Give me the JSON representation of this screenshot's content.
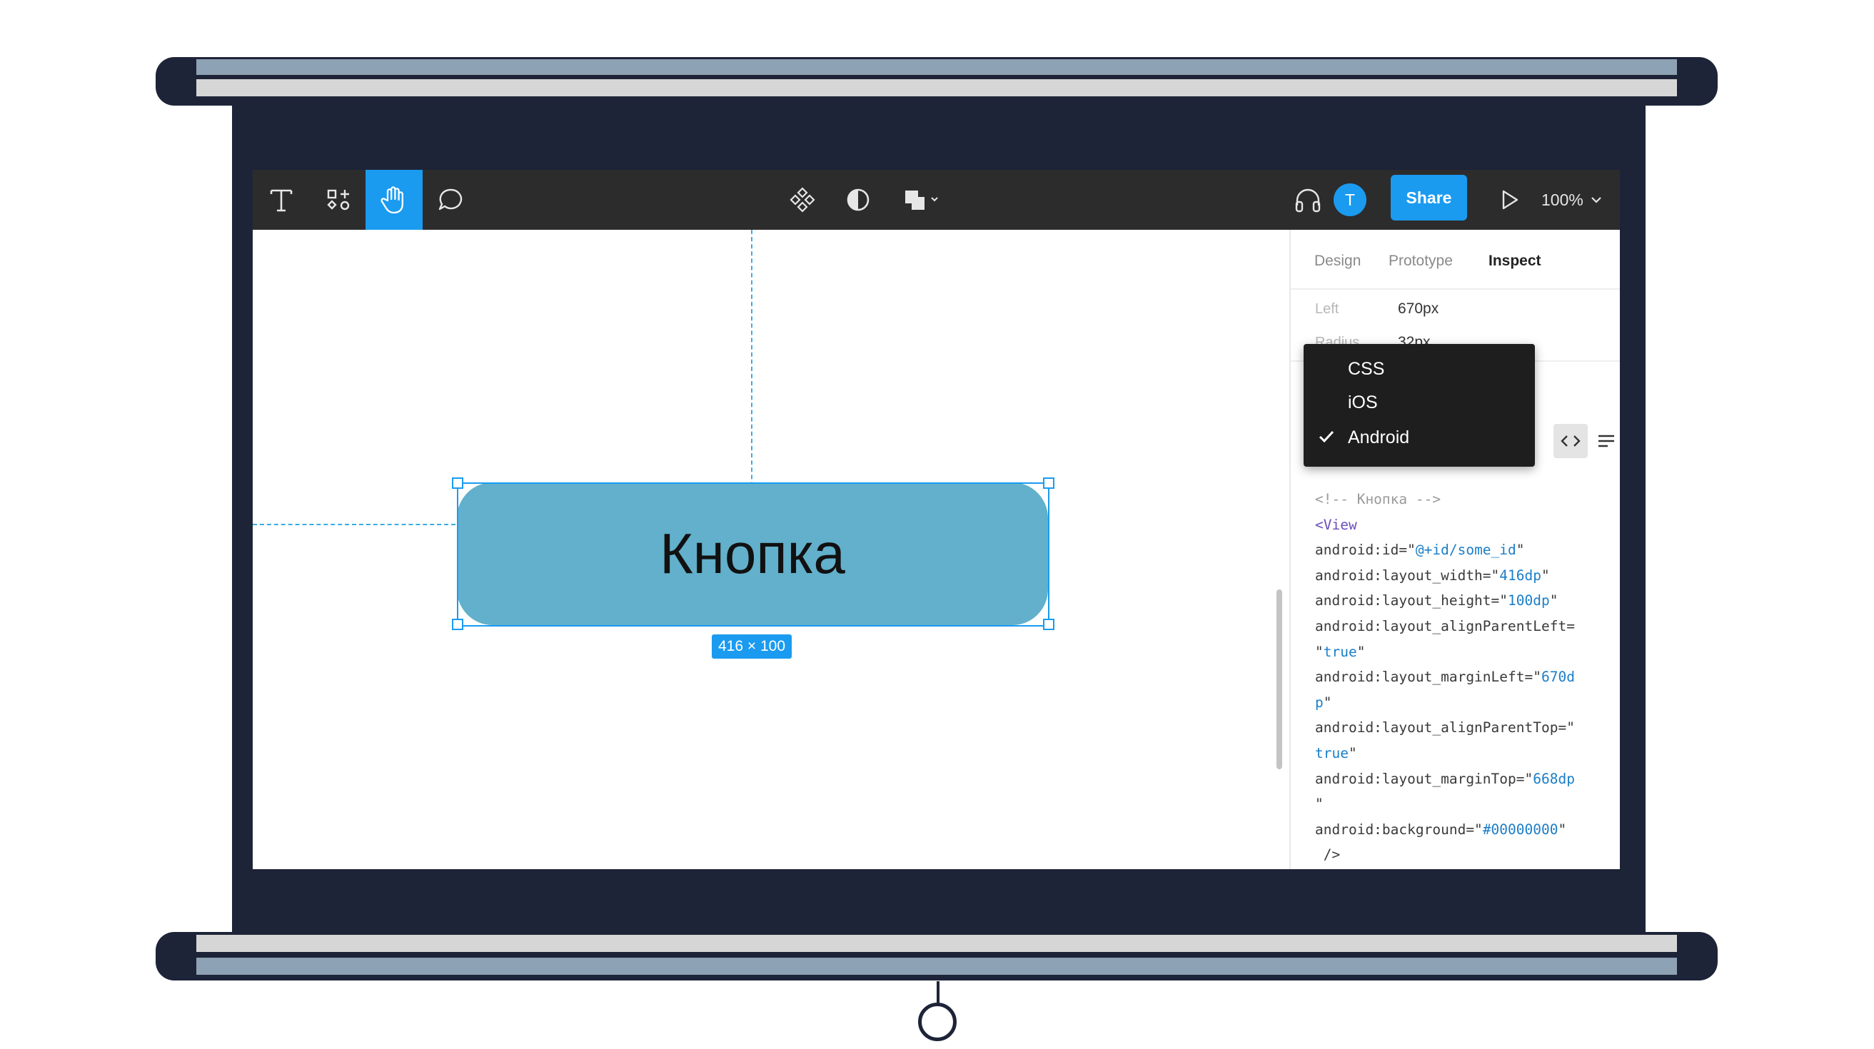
{
  "toolbar": {
    "tools_left": [
      "text-tool",
      "components-tool",
      "hand-tool",
      "comment-tool"
    ],
    "share_label": "Share",
    "avatar_initial": "T",
    "zoom_label": "100%"
  },
  "canvas": {
    "button_text": "Кнопка",
    "size_badge": "416 × 100",
    "button_color": "#62b0cb",
    "selection_color": "#1a9bf0"
  },
  "panel": {
    "tabs": [
      {
        "label": "Design"
      },
      {
        "label": "Prototype"
      },
      {
        "label": "Inspect"
      }
    ],
    "props": [
      {
        "label": "Left",
        "value": "670px"
      },
      {
        "label": "Radius",
        "value": "32px"
      }
    ],
    "code_lines": [
      {
        "parts": [
          {
            "t": "<!-- Кнопка -->",
            "c": "cm"
          }
        ]
      },
      {
        "parts": [
          {
            "t": "<View",
            "c": "tg"
          }
        ]
      },
      {
        "parts": [
          {
            "t": "android:id=\"",
            "c": ""
          },
          {
            "t": "@+id/some_id",
            "c": "st"
          },
          {
            "t": "\"",
            "c": ""
          }
        ]
      },
      {
        "parts": [
          {
            "t": "android:layout_width=\"",
            "c": ""
          },
          {
            "t": "416dp",
            "c": "st"
          },
          {
            "t": "\"",
            "c": ""
          }
        ]
      },
      {
        "parts": [
          {
            "t": "android:layout_height=\"",
            "c": ""
          },
          {
            "t": "100dp",
            "c": "st"
          },
          {
            "t": "\"",
            "c": ""
          }
        ]
      },
      {
        "parts": [
          {
            "t": "android:layout_alignParentLeft=",
            "c": ""
          }
        ]
      },
      {
        "parts": [
          {
            "t": "\"",
            "c": ""
          },
          {
            "t": "true",
            "c": "st"
          },
          {
            "t": "\"",
            "c": ""
          }
        ]
      },
      {
        "parts": [
          {
            "t": "android:layout_marginLeft=\"",
            "c": ""
          },
          {
            "t": "670d",
            "c": "st"
          }
        ]
      },
      {
        "parts": [
          {
            "t": "p",
            "c": "st"
          },
          {
            "t": "\"",
            "c": ""
          }
        ]
      },
      {
        "parts": [
          {
            "t": "android:layout_alignParentTop=\"",
            "c": ""
          }
        ]
      },
      {
        "parts": [
          {
            "t": "true",
            "c": "st"
          },
          {
            "t": "\"",
            "c": ""
          }
        ]
      },
      {
        "parts": [
          {
            "t": "android:layout_marginTop=\"",
            "c": ""
          },
          {
            "t": "668dp",
            "c": "st"
          }
        ]
      },
      {
        "parts": [
          {
            "t": "\"",
            "c": ""
          }
        ]
      },
      {
        "parts": [
          {
            "t": "android:background=\"",
            "c": ""
          },
          {
            "t": "#00000000",
            "c": "st"
          },
          {
            "t": "\"",
            "c": ""
          }
        ]
      },
      {
        "parts": [
          {
            "t": " />",
            "c": ""
          }
        ]
      }
    ]
  },
  "dropdown": {
    "items": [
      {
        "label": "CSS",
        "checked": false
      },
      {
        "label": "iOS",
        "checked": false
      },
      {
        "label": "Android",
        "checked": true
      }
    ]
  }
}
